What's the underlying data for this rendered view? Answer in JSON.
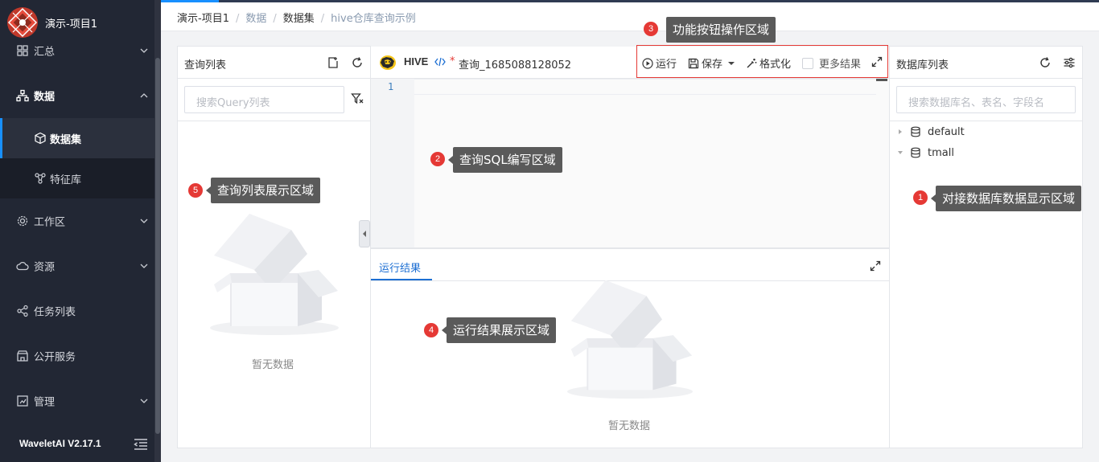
{
  "app": {
    "project_name": "演示-项目1",
    "version": "WaveletAI V2.17.1"
  },
  "sidebar": {
    "items": [
      {
        "label": "汇总",
        "icon": "grid-icon",
        "expandable": true
      },
      {
        "label": "数据",
        "icon": "sitemap-icon",
        "expandable": true,
        "expanded": true
      },
      {
        "label": "工作区",
        "icon": "cog-icon",
        "expandable": true
      },
      {
        "label": "资源",
        "icon": "cloud-icon",
        "expandable": true
      },
      {
        "label": "任务列表",
        "icon": "nodes-icon",
        "expandable": false
      },
      {
        "label": "公开服务",
        "icon": "shop-icon",
        "expandable": false
      },
      {
        "label": "管理",
        "icon": "chart-icon",
        "expandable": true
      }
    ],
    "sub_items": [
      {
        "label": "数据集",
        "icon": "cube-icon",
        "selected": true
      },
      {
        "label": "特征库",
        "icon": "molecule-icon",
        "selected": false
      }
    ]
  },
  "breadcrumb": [
    "演示-项目1",
    "数据",
    "数据集",
    "hive仓库查询示例"
  ],
  "query_list": {
    "title": "查询列表",
    "search_placeholder": "搜索Query列表",
    "empty_text": "暂无数据"
  },
  "editor": {
    "engine": "HIVE",
    "unsaved_mark": "*",
    "query_name": "查询_1685088128052",
    "line_numbers": [
      "1"
    ],
    "toolbar": {
      "run": "运行",
      "save": "保存",
      "format": "格式化",
      "more_results": "更多结果"
    }
  },
  "results": {
    "tab_label": "运行结果",
    "empty_text": "暂无数据"
  },
  "db_list": {
    "title": "数据库列表",
    "search_placeholder": "搜索数据库名、表名、字段名",
    "databases": [
      "default",
      "tmall"
    ]
  },
  "annotations": [
    {
      "num": "1",
      "text": "对接数据库数据显示区域"
    },
    {
      "num": "2",
      "text": "查询SQL编写区域"
    },
    {
      "num": "3",
      "text": "功能按钮操作区域"
    },
    {
      "num": "4",
      "text": "运行结果展示区域"
    },
    {
      "num": "5",
      "text": "查询列表展示区域"
    }
  ],
  "colors": {
    "sidebar_bg": "#222734",
    "accent": "#1890ff",
    "link": "#1d6fd3",
    "annotation_red": "#e53935",
    "callout_bg": "#5a5a5a"
  }
}
